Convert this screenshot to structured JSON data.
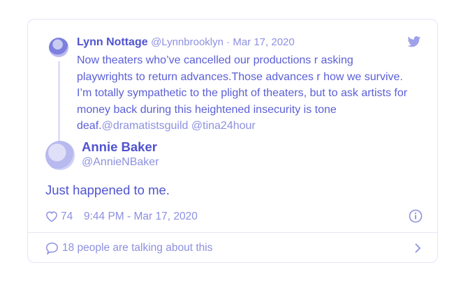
{
  "quoted_tweet": {
    "name": "Lynn Nottage",
    "handle": "@Lynnbrooklyn",
    "date": "Mar 17, 2020",
    "body_lines": [
      "Now theaters who’ve cancelled our productions r asking",
      "playwrights to return advances.Those advances r how we survive.",
      "I’m totally sympathetic to the plight of theaters, but to ask artists for",
      "money back during this heightened insecurity is tone"
    ],
    "last_line_prefix": "deaf.",
    "mentions": [
      "@dramatistsguild",
      "@tina24hour"
    ]
  },
  "tweet": {
    "name": "Annie Baker",
    "handle": "@AnnieNBaker",
    "text": "Just happened to me.",
    "likes": "74",
    "timestamp": "9:44 PM - Mar 17, 2020"
  },
  "footer": {
    "talking": "18 people are talking about this"
  },
  "icons": {
    "brand": "twitter-bird-icon",
    "like": "heart-icon",
    "info": "info-icon",
    "reply": "speech-bubble-icon",
    "more": "chevron-right-icon"
  },
  "colors": {
    "accent": "#5b5fd6",
    "muted": "#8d90e0",
    "border": "#e3e4f8"
  }
}
